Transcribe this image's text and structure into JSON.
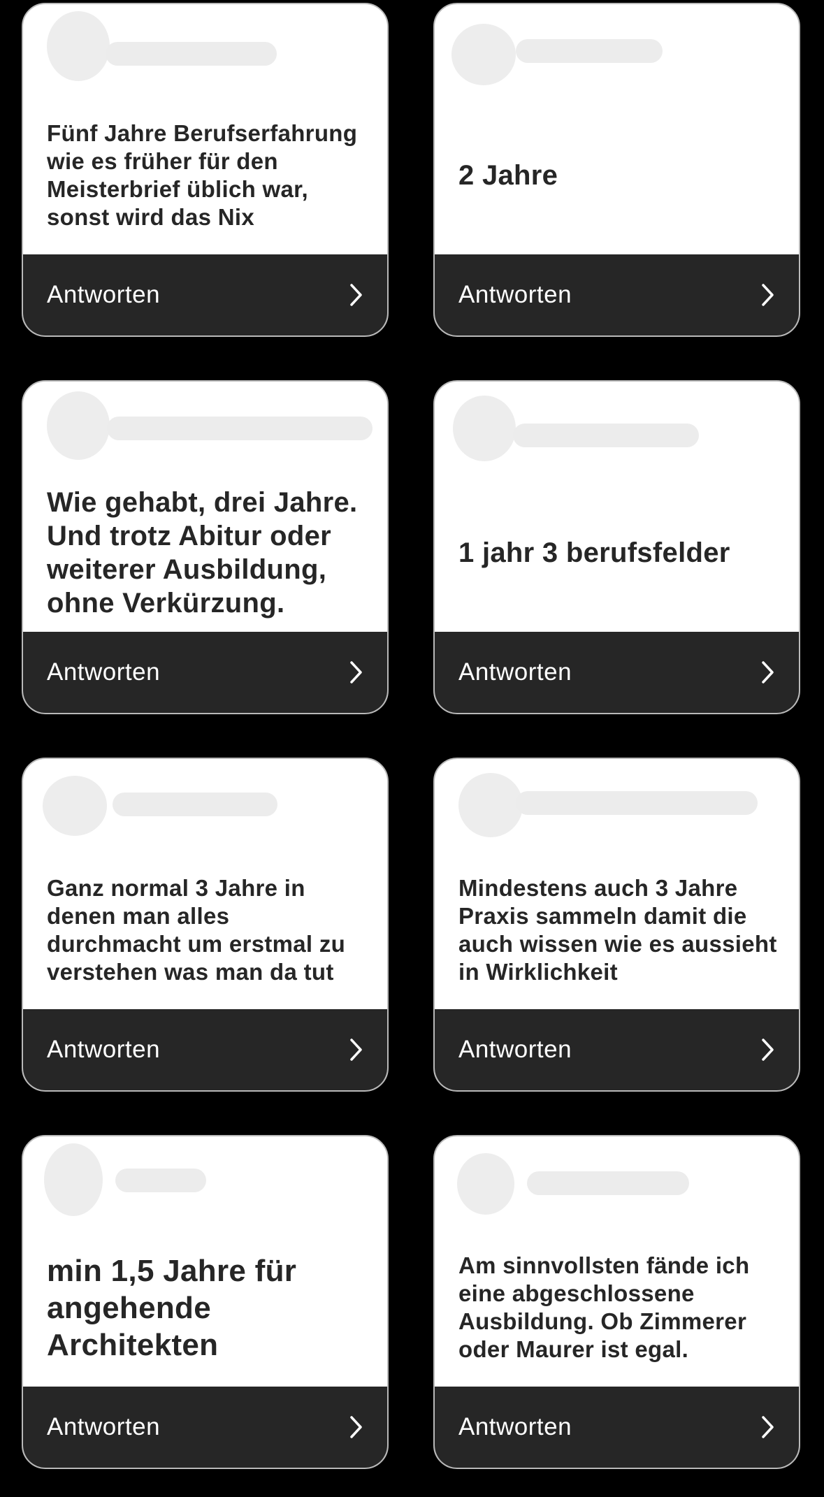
{
  "reply_label": "Antworten",
  "cards": [
    {
      "text": "Fünf Jahre Berufserfahrung wie es früher für den Meisterbrief üblich war, sonst wird das Nix"
    },
    {
      "text": "2 Jahre"
    },
    {
      "text": "Wie gehabt, drei Jahre. Und trotz Abitur oder weiterer Ausbildung, ohne Verkürzung."
    },
    {
      "text": "1 jahr 3 berufsfelder"
    },
    {
      "text": "Ganz normal 3 Jahre in denen man alles durchmacht um erstmal zu verstehen was man da tut"
    },
    {
      "text": "Mindestens auch 3 Jahre Praxis sammeln damit die auch wissen wie es aussieht in Wirklichkeit"
    },
    {
      "text": "min 1,5 Jahre für angehende Architekten"
    },
    {
      "text": "Am sinnvollsten fände ich eine abgeschlossene Ausbildung. Ob Zimmerer oder Maurer ist egal."
    }
  ]
}
